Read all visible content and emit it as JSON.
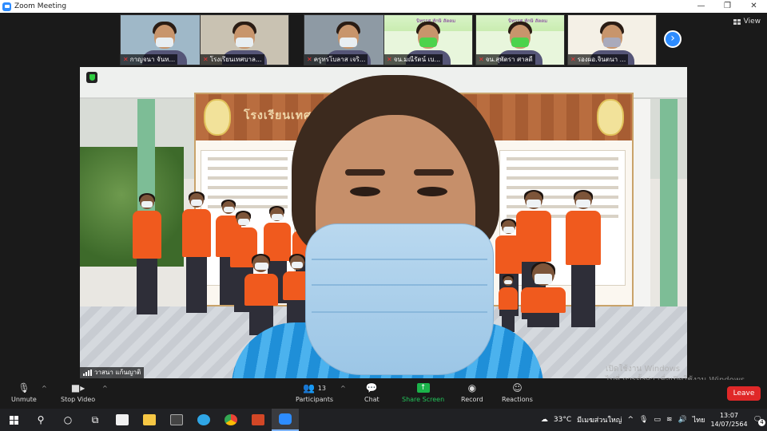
{
  "window": {
    "title": "Zoom Meeting",
    "controls": [
      "—",
      "❐",
      "✕"
    ]
  },
  "view_button": {
    "label": "View"
  },
  "thumbnails": [
    {
      "name": "กาญจนา จันท...",
      "mask": "white",
      "bg": "#9fb8c8"
    },
    {
      "name": "โรงเรียนเทศบาล...",
      "mask": "white",
      "bg": "#c9c2b2"
    },
    {
      "name": "ครูทรโบลาส เจริ...",
      "mask": "white",
      "bg": "#8e9aa4"
    },
    {
      "name": "จน.มณีรัตน์ เบ...",
      "mask": "green",
      "bg": "#e8f6dc"
    },
    {
      "name": "จน.สุพัตรา ศาลดี",
      "mask": "green",
      "bg": "#e8f6dc"
    },
    {
      "name": "รองผอ.จินตนา ...",
      "mask": "gray",
      "bg": "#f4f0e6"
    }
  ],
  "thumb_banner": "นิทรรศ ทักษิ สัตตม",
  "main_video": {
    "name": "วาสนา แก้นญาติ",
    "board_title": "โรงเรียนเทศบาล ๓ วัดกลางขอนแก่น"
  },
  "watermark": {
    "line1": "เปิดใช้งาน Windows",
    "line2": "ไปที่ การตั้งค่า เพื่อเปิดใช้งาน Windows"
  },
  "toolbar": {
    "unmute": "Unmute",
    "stop_video": "Stop Video",
    "participants": "Participants",
    "participants_count": "13",
    "chat": "Chat",
    "share_screen": "Share Screen",
    "record": "Record",
    "reactions": "Reactions",
    "leave": "Leave"
  },
  "taskbar": {
    "temperature": "33°C",
    "weather": "มีเมฆส่วนใหญ่",
    "language": "ไทย",
    "time": "13:07",
    "date": "14/07/2564",
    "notifications": "4"
  },
  "colors": {
    "zoom_blue": "#2d8cff",
    "share_green": "#23c45a",
    "leave_red": "#e02828",
    "shirt_orange": "#f05a1e"
  }
}
